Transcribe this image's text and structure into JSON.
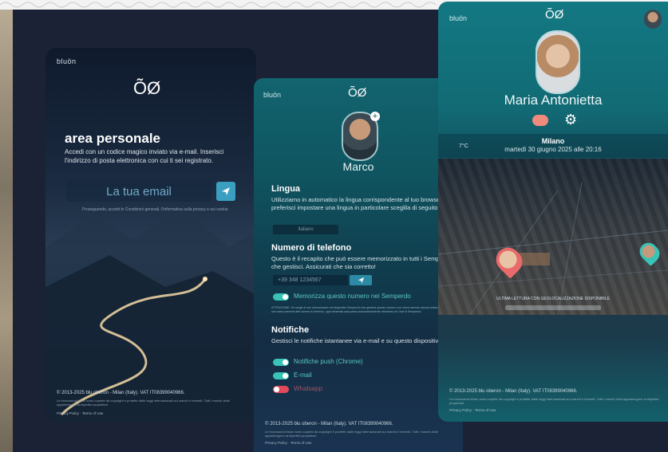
{
  "colors": {
    "background": "#1c2236",
    "accent": "#37c3b5",
    "send": "#3a9fc0",
    "alert": "#e4495a"
  },
  "login": {
    "brand": "bluön",
    "logo": "ÕØ",
    "title": "area personale",
    "description": "Accedi con un codice magico inviato via e-mail. Inserisci l'indirizzo di posta elettronica con cui ti sei registrato.",
    "email_placeholder": "La tua email",
    "send_icon": "send-icon",
    "legal": "Proseguendo, accetti le Condizioni generali, l'Informativa sulla privacy e sui cookie.",
    "copyright": "© 2013-2025 blu oberon - Milan (Italy). VAT IT08399040966.",
    "fine_print": "Le innovazioni bluon sono coperte da copyright e protette dalle leggi internazionali sui marchi e brevetti. Tutti i marchi citati appartengono ai rispettivi proprietari.",
    "links": "Privacy Policy · Terms of Use"
  },
  "profile": {
    "brand": "bluön",
    "logo": "ÕØ",
    "name": "Marco",
    "plus": "+",
    "language_title": "Lingua",
    "language_text": "Utilizziamo in automatico la lingua corrispondente al tuo browser. Se preferisci impostare una lingua in particolare sceglila di seguito.",
    "language_value": "Italiano",
    "phone_title": "Numero di telefono",
    "phone_text": "Questo è il recapito che può essere memorizzato in tutti i Semperdo che gestisci. Assicurati che sia corretto!",
    "phone_value": "+39 348 1234567",
    "memorize_label": "Memorizza questo numero nei Semperdo",
    "warning": "ATTENZIONE: Se scegli di non memorizzare nei dispositivi Semperdo che gestisci questo numero non verrà ricevuto alcuna chiamata. In caso non siano presenti altri numeri di telefono, ogni chiamata sarà presa automaticamente attraverso la Chat di Semperdo.",
    "notifications_title": "Notifiche",
    "notifications_text": "Gestisci le notifiche istantanee via e-mail e su questo dispositivo.",
    "toggles": [
      {
        "label": "Notifiche push (Chrome)"
      },
      {
        "label": "E-mail"
      },
      {
        "label": "Whatsapp"
      }
    ],
    "copyright": "© 2013-2025 blu oberon - Milan (Italy). VAT IT08399040966.",
    "fine_print": "Le innovazioni bluon sono coperte da copyright e protette dalle leggi internazionali sui marchi e brevetti. Tutti i marchi citati appartengono ai rispettivi proprietari.",
    "links": "Privacy Policy · Terms of Use"
  },
  "dashboard": {
    "brand": "bluön",
    "logo": "ÕØ",
    "name": "Maria Antonietta",
    "gear": "⚙",
    "temperature": "7°C",
    "city": "Milano",
    "date": "martedì 30 giugno 2025 alle 20:16",
    "last_reading": "ULTIMA LETTURA CON GEOLOCALIZZAZIONE DISPONIBILE",
    "copyright": "© 2013-2025 blu oberon - Milan (Italy). VAT IT08399040966.",
    "fine_print": "Le innovazioni bluon sono coperte da copyright e protette dalle leggi internazionali sui marchi e brevetti. Tutti i marchi citati appartengono ai rispettivi proprietari.",
    "links": "Privacy Policy · Terms of Use"
  }
}
